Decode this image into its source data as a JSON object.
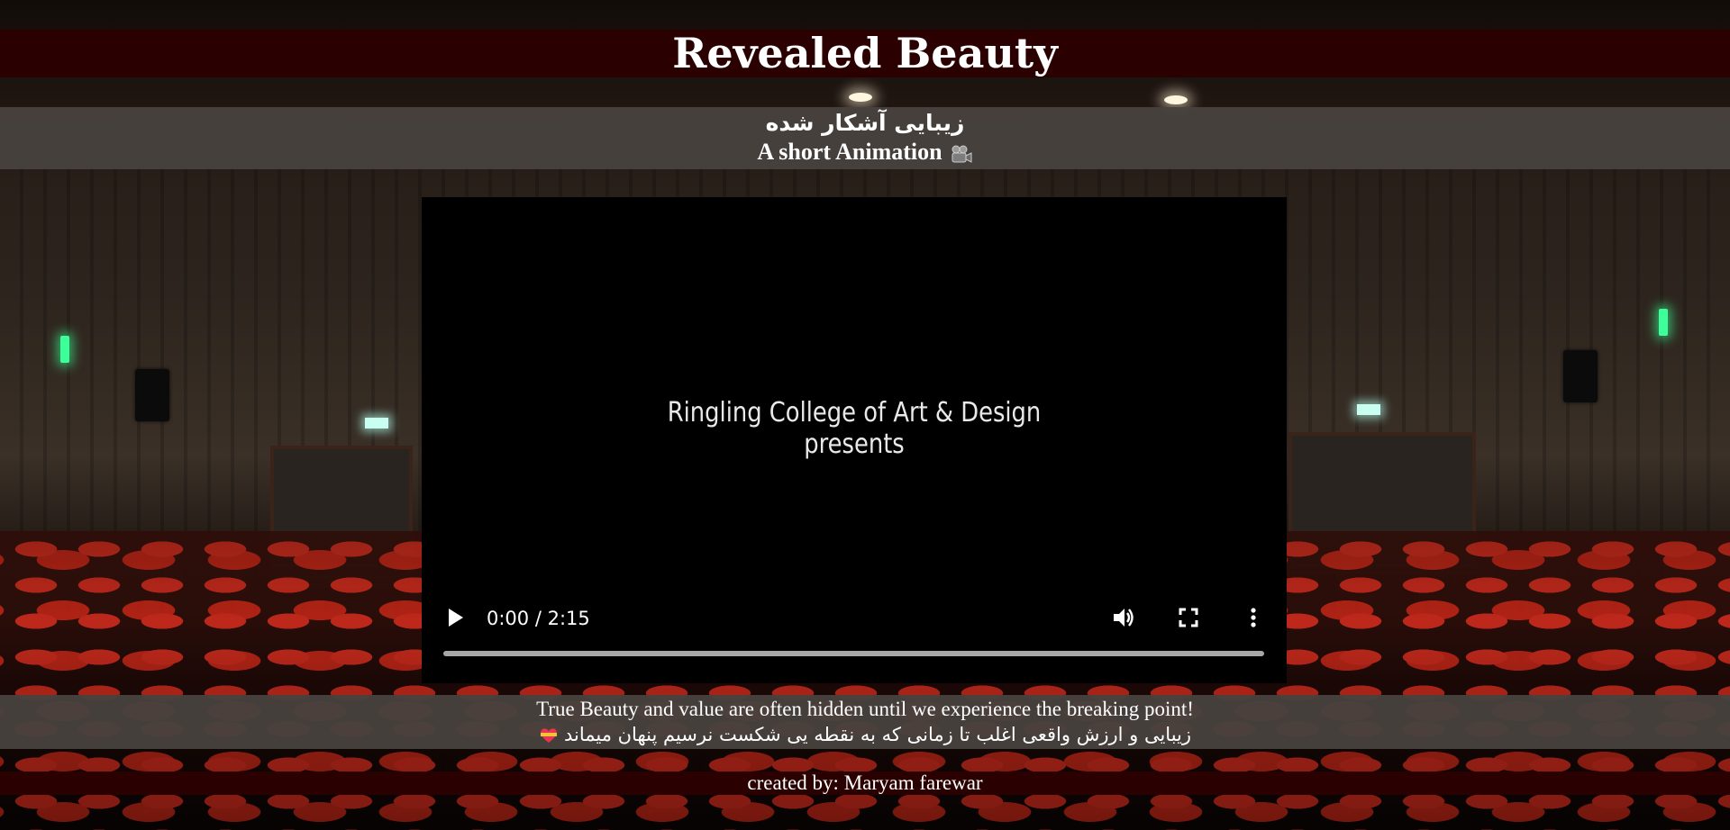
{
  "header": {
    "title": "Revealed Beauty",
    "subtitle_fa": "زیبایی آشکار شده",
    "subtitle_en": "A short Animation"
  },
  "video": {
    "frame_text_line1": "Ringling College of Art & Design",
    "frame_text_line2": "presents",
    "time_display": "0:00 / 2:15",
    "progress": 0,
    "controls": {
      "play": "play-icon",
      "volume": "volume-icon",
      "fullscreen": "fullscreen-icon",
      "menu": "more-vertical-icon"
    }
  },
  "tagline": {
    "en": "True Beauty and value are often hidden until we experience the breaking point!",
    "fa": "زیبایی و ارزش واقعی اغلب تا زمانی که به نقطه یی شکست نرسیم پنهان میماند"
  },
  "footer": {
    "credit": "created by: Maryam farewar"
  },
  "colors": {
    "title_band": "#2a0000",
    "info_band": "#48423e",
    "text": "#ffffff",
    "video_bg": "#000000"
  }
}
